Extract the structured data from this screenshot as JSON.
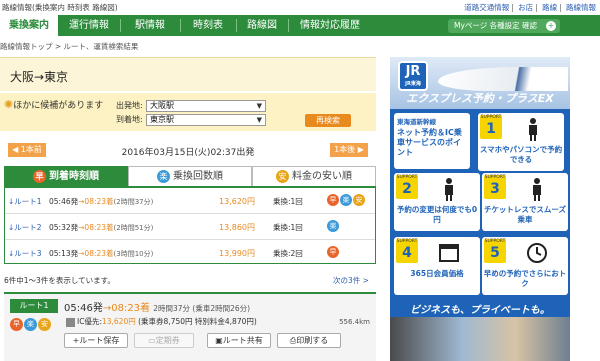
{
  "topbar": {
    "crumb": "路線情報(乗換案内 時刻表 路線図)",
    "links": [
      "道路交通情報",
      "お店",
      "路線",
      "路線情報"
    ]
  },
  "nav": {
    "tabs": [
      "乗換案内",
      "運行情報",
      "駅情報",
      "時刻表",
      "路線図",
      "情報対応履歴"
    ],
    "mypage": "Myページ 各種設定 確認"
  },
  "breadcrumb": "路線情報トップ > ルート、運賃検索結果",
  "route_title": "大阪→東京",
  "candidates": {
    "label": "ほかに候補があります",
    "from_label": "出発地:",
    "from_value": "大阪駅",
    "to_label": "到着地:",
    "to_value": "東京駅",
    "research": "再検索"
  },
  "nav_buttons": {
    "prev": "1本前",
    "next": "1本後"
  },
  "depart_text": "2016年03月15日(火)02:37出発",
  "sort_tabs": [
    {
      "icon": "早",
      "label": "到着時刻順"
    },
    {
      "icon": "楽",
      "label": "乗換回数順"
    },
    {
      "icon": "安",
      "label": "料金の安い順"
    }
  ],
  "routes": [
    {
      "label": "↓ルート1",
      "dep": "05:46発",
      "arr": "08:23着",
      "dur": "(2時間37分)",
      "fare": "13,620円",
      "transfers": "乗換:1回",
      "badges": [
        "早",
        "楽",
        "安"
      ]
    },
    {
      "label": "↓ルート2",
      "dep": "05:32発",
      "arr": "08:23着",
      "dur": "(2時間51分)",
      "fare": "13,860円",
      "transfers": "乗換:1回",
      "badges": [
        "楽"
      ]
    },
    {
      "label": "↓ルート3",
      "dep": "05:13発",
      "arr": "08:23着",
      "dur": "(3時間10分)",
      "fare": "13,990円",
      "transfers": "乗換:2回",
      "badges": [
        "早"
      ]
    }
  ],
  "count_text": "6件中1〜3件を表示しています。",
  "next_page": "次の3件 >",
  "detail": {
    "route_tag": "ルート1",
    "dep": "05:46発",
    "arr": "08:23着",
    "dur": "2時間37分 (乗車2時間26分)",
    "badges": [
      "早",
      "楽",
      "安"
    ],
    "ic_label": "IC優先:",
    "ic_fare": "13,620円",
    "ic_detail": "(乗車券8,750円 特別料金4,870円)",
    "distance": "556.4km",
    "actions": [
      "ルート保存",
      "定期券",
      "ルート共有",
      "印刷する"
    ]
  },
  "ad": {
    "logo": "JR",
    "logo_sub": "JR東海",
    "headline": "エクスプレス予約・プラスEX",
    "intro_1": "東海道新幹線",
    "intro_2": "ネット予約＆IC乗車サービスのポイント",
    "cards": [
      {
        "n": "1",
        "text": "スマホやパソコンで予約できる"
      },
      {
        "n": "2",
        "text": "予約の変更は何度でも0円"
      },
      {
        "n": "3",
        "text": "チケットレスでスムーズ乗車"
      },
      {
        "n": "4",
        "text": "365日会員価格"
      },
      {
        "n": "5",
        "text": "早めの予約でさらにおトク"
      }
    ],
    "support_label": "SUPPORT",
    "tagline": "ビジネスも、プライベートも。"
  },
  "colors": {
    "brand_green": "#2d8c3c",
    "accent_orange": "#e88a1e",
    "ad_blue": "#1f63b8"
  }
}
